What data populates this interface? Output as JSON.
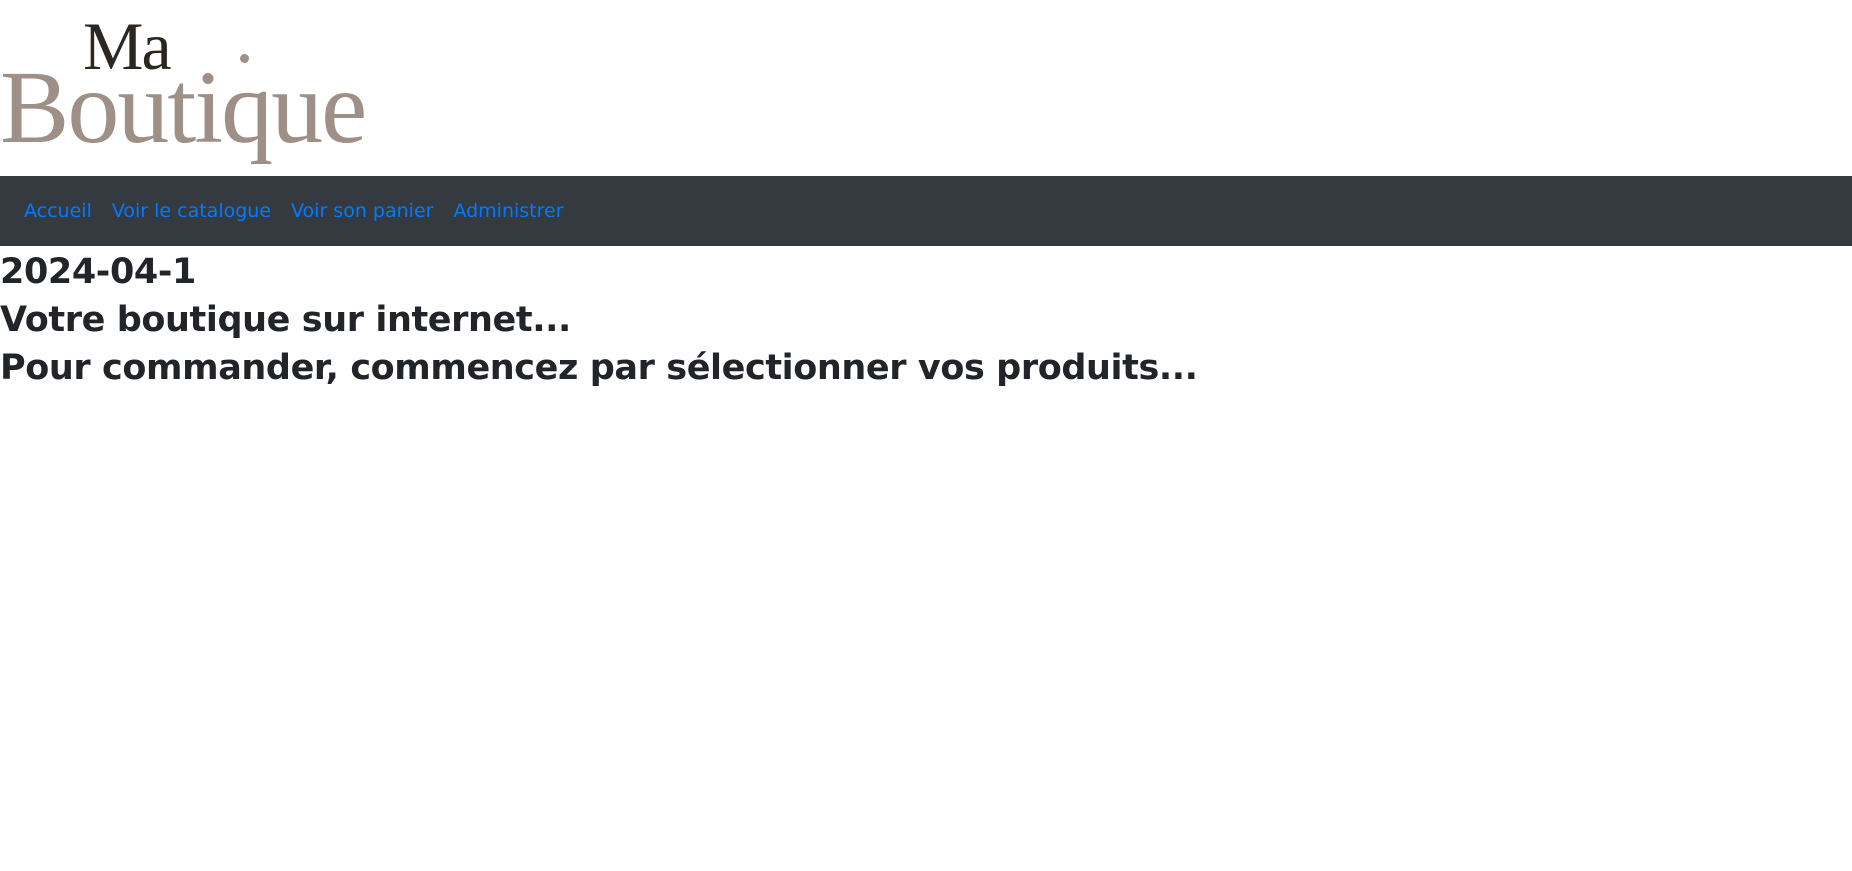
{
  "logo": {
    "line1": "Ma",
    "line2": "Boutique"
  },
  "nav": {
    "items": [
      {
        "label": "Accueil"
      },
      {
        "label": "Voir le catalogue"
      },
      {
        "label": "Voir son panier"
      },
      {
        "label": "Administrer"
      }
    ]
  },
  "main": {
    "date": "2024-04-1",
    "tagline": "Votre boutique sur internet...",
    "instruction": "Pour commander, commencez par sélectionner vos produits..."
  }
}
